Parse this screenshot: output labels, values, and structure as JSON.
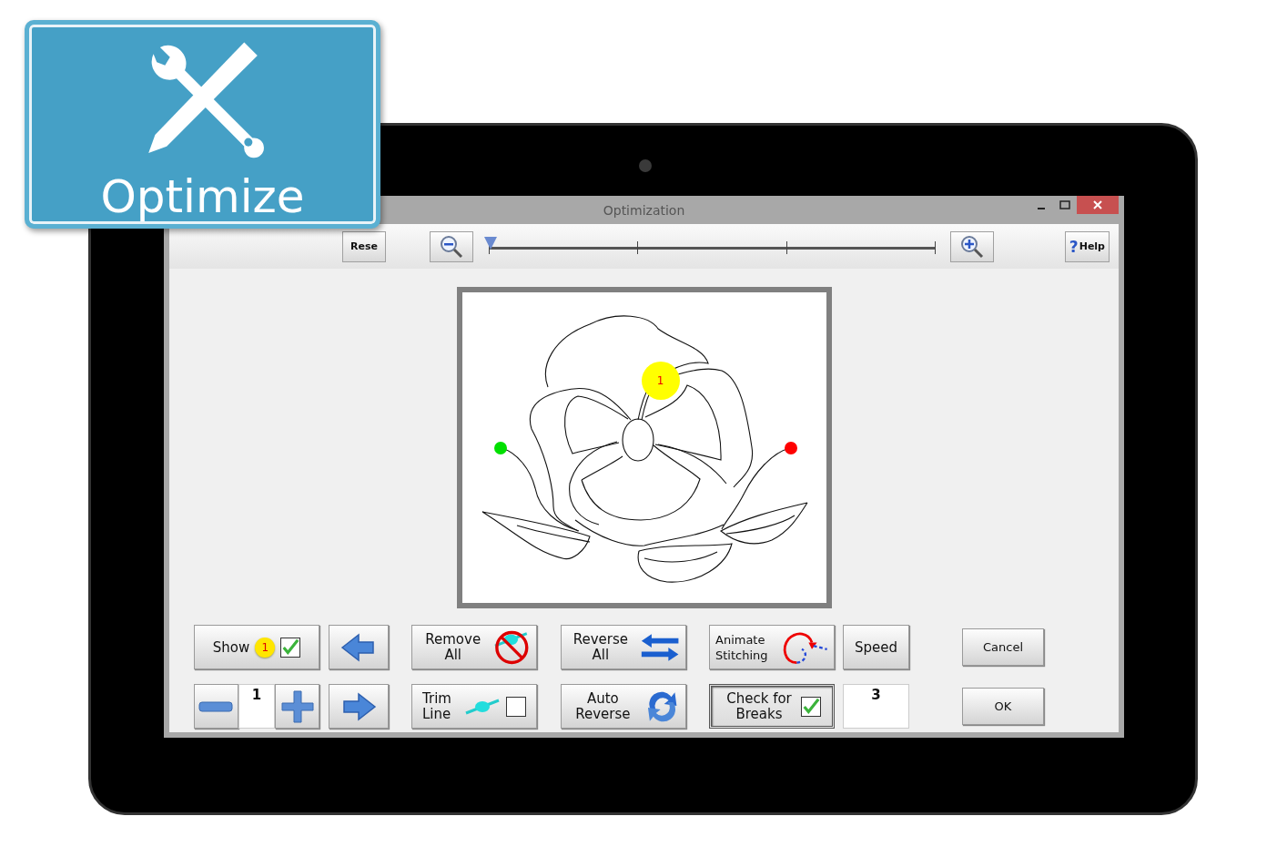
{
  "badge": {
    "label": "Optimize"
  },
  "window": {
    "title": "Optimization"
  },
  "toolbar": {
    "reset_button": "Rese",
    "zoom": {
      "level": 0
    },
    "help": {
      "glyph": "?",
      "label": "Help"
    }
  },
  "canvas": {
    "sequence_marker": "1"
  },
  "controls": [
    [
      {
        "kind": "show",
        "label": "Show",
        "marker": "1",
        "checked": true
      },
      {
        "kind": "prev"
      },
      {
        "kind": "remove",
        "label": "Remove All"
      },
      {
        "kind": "reverse",
        "label": "Reverse All"
      },
      {
        "kind": "animate",
        "label": "Animate Stitching"
      },
      {
        "kind": "speed",
        "label": "Speed"
      },
      {
        "kind": "cancel",
        "label": "Cancel"
      }
    ],
    [
      {
        "kind": "stepper",
        "value": "1"
      },
      {
        "kind": "next"
      },
      {
        "kind": "trim",
        "label": "Trim Line",
        "checked": false
      },
      {
        "kind": "auto_reverse",
        "label": "Auto Reverse"
      },
      {
        "kind": "breaks",
        "label": "Check for Breaks",
        "checked": true,
        "pressed": true
      },
      {
        "kind": "value_field",
        "value": "3"
      },
      {
        "kind": "ok",
        "label": "OK"
      }
    ]
  ]
}
